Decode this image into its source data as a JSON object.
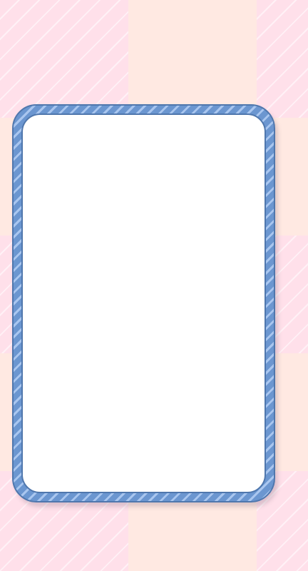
{
  "background": {
    "pattern": "checkerboard",
    "colors": {
      "pink": "#ffe0ea",
      "peach": "#ffe9e2",
      "stripe": "#ffffff"
    }
  },
  "card": {
    "state": "blank",
    "colors": {
      "frame_outer": "#6b96d0",
      "frame_stripe": "#a9c6ef",
      "frame_border": "#4f77ad",
      "fill": "#ffffff"
    }
  }
}
